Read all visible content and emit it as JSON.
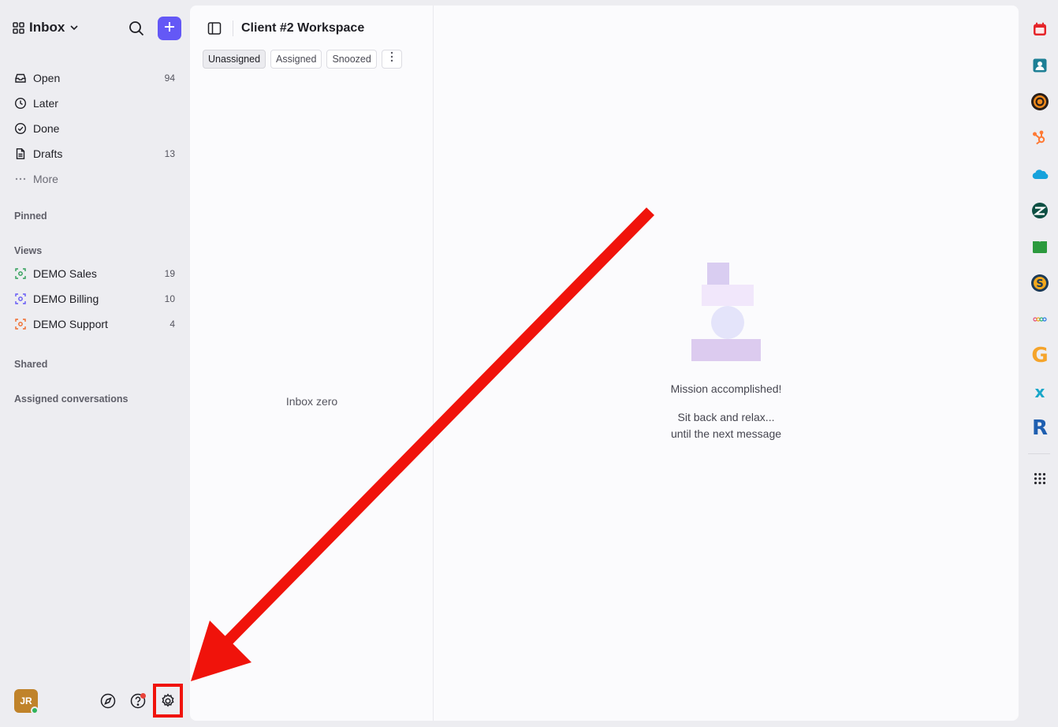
{
  "sidebar": {
    "inbox_label": "Inbox",
    "nav": [
      {
        "label": "Open",
        "count": "94"
      },
      {
        "label": "Later",
        "count": ""
      },
      {
        "label": "Done",
        "count": ""
      },
      {
        "label": "Drafts",
        "count": "13"
      },
      {
        "label": "More",
        "count": ""
      }
    ],
    "sections": {
      "pinned": "Pinned",
      "views": "Views",
      "shared": "Shared",
      "assigned": "Assigned conversations"
    },
    "views": [
      {
        "label": "DEMO Sales",
        "count": "19",
        "color": "#2e9e57"
      },
      {
        "label": "DEMO Billing",
        "count": "10",
        "color": "#6458f6"
      },
      {
        "label": "DEMO Support",
        "count": "4",
        "color": "#f06a2a"
      }
    ],
    "user_initials": "JR"
  },
  "main": {
    "workspace_title": "Client #2 Workspace",
    "filters": [
      "Unassigned",
      "Assigned",
      "Snoozed"
    ],
    "active_filter": "Unassigned",
    "list_empty": "Inbox zero",
    "empty_title": "Mission accomplished!",
    "empty_line1": "Sit back and relax...",
    "empty_line2": "until the next message"
  },
  "rail": {
    "apps": [
      "calendar-icon",
      "contacts-icon",
      "target-app-icon",
      "hubspot-icon",
      "salesforce-icon",
      "zendesk-icon",
      "book-app-icon",
      "s-app-icon",
      "dots-app-icon",
      "g-app-icon",
      "x-app-icon",
      "r-app-icon"
    ],
    "g_letter": "G",
    "x_letter": "x",
    "r_letter": "R"
  },
  "colors": {
    "accent": "#6458f6",
    "annotation": "#f0130b"
  }
}
